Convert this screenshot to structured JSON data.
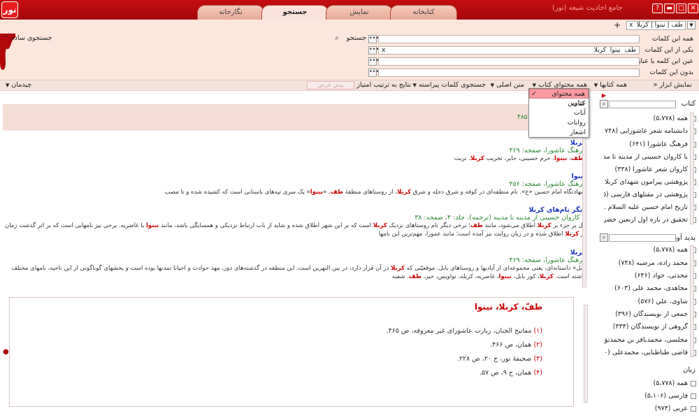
{
  "window": {
    "title": "جامع احادیث شیعه (نور)",
    "logo_text": "نور",
    "help": "?"
  },
  "tabs": [
    "نگارخانه",
    "جستجو",
    "نمایش",
    "کتابخانه"
  ],
  "query_tab": {
    "label": "طف | نینوا | کربلا",
    "close": "x",
    "add": "+"
  },
  "search": {
    "labels": [
      "همه این کلمات",
      "یکی از این کلمات",
      "عین این کلمه یا عبارت",
      "بدون این کلمات"
    ],
    "values": [
      "",
      "طف  نینوا  کربلا",
      "",
      ""
    ],
    "clear": "x",
    "search_button": "جستجو",
    "simple_search": "جستجوی ساده"
  },
  "toolbar": {
    "tools": "نمایش ابزار",
    "all_books": "همه کتابها",
    "all_content": "همه محتوای کتاب",
    "main_text": "متن اصلی",
    "refined": "جستجوی کلمات پیراسته",
    "sort": "نتایج به ترتیب امتیاز",
    "default": "پیش فرض",
    "layout": "چیدمان"
  },
  "dropdown": [
    "همه محتوای کتاب",
    "عناوین",
    "آیات",
    "روایات",
    "اشعار"
  ],
  "banner_count": "۴۸۵",
  "results": [
    {
      "title": "کربلا",
      "sub": "فرهنگ عاشورا، صفحه: ۳۶۹",
      "text_parts": [
        "-",
        "طف",
        "، ",
        "نینوا",
        ". حرم حسینی، حایر، تخریب ",
        "کربلا",
        ". تربت"
      ]
    },
    {
      "title": "نینوا",
      "sub": "فرهنگ عاشورا، صفحه: ۴۵۶",
      "text_parts": [
        "شهادتگاه امام حسین «ع». نام منطقه‌ای در کوفه و شرق دجله و شرق ",
        "کربلا",
        "، از روستاهای منطقهٔ ",
        "طف",
        ". «",
        "نینوا",
        "» یک سری تپه‌های باستانی است که کشیده شده و تا مصب"
      ]
    },
    {
      "title": "دیگر نام‌های کربلا",
      "sub": "با کاروان حسینی از مدینه تا مدینه (ترجمه)، جلد: ۴، صفحه: ۳۸",
      "text_parts": [
        "کل بر جزء بر ",
        "کربلا",
        " اطلاق می‌شود، مانند ",
        "طف",
        "؛ برخی دیگر نام روستاهای نزدیک ",
        "کربلا",
        " است که بر این شهر اطلاق شده و شاید از باب ارتباط نزدیکی و همسایگی باشد، مانند ",
        "نینوا",
        " یا غاضریه. برخی نیز نامهایی است که بر اثر گذشت زمان بر ",
        "کربلا",
        " اطلاق شده و در زبان روایت نیز آمده است؛ مانند عمورا. مهم‌ترین این نامها"
      ]
    },
    {
      "title": "کربلا",
      "sub": "فرهنگ عاشورا، صفحه: ۳۶۹",
      "text_parts": [
        "بابل» داستانه‌ای، یعنی مجموعه‌ای از آبادیها و روستاهای بابل. موقعیّتی که ",
        "کربلا",
        " در آن قرار دارد، در بین النهرین است. این منطقه در گذشته‌های دور، مهد حوادث و احیانا تمدنها بوده است و بخشهای گوناگونی از این ناحیه، نامهای مختلف داشته است. ",
        "کربلا",
        "، کور بابل، ",
        "نینوا",
        "، غاضریه، کربله، نواویس، حیر، ",
        "طف",
        ". شفیه"
      ]
    }
  ],
  "doc": {
    "title_parts": [
      "طفّ",
      "، ",
      "کربلا",
      "، ",
      "نینوا"
    ],
    "lines": [
      {
        "num": "(۱)",
        "text": " مفاتیح الجنان، زیارت عاشورای غیر معروفه، ص ۴۶۵."
      },
      {
        "num": "(۲)",
        "text": " همان، ص ۴۶۶."
      },
      {
        "num": "(۳)",
        "text": " صحیفهٔ نور، ج ۲۰، ص ۲۲۸."
      },
      {
        "num": "(۴)",
        "text": " همان، ج ۹، ص ۵۷."
      }
    ]
  },
  "sidebar": {
    "books_header": "کتاب",
    "books": [
      "همه (۵،۷۷۸)",
      "دانشنامه شعر عاشورایی (۷۴۸)",
      "فرهنگ عاشورا (۶۴۱)",
      "با کاروان حسینی از مدینه تا مدی...",
      "کاروان شعر عاشورا (۳۳۸)",
      "پژوهشی پیرامون شهدای کربلا (...",
      "پژوهشی در مقتلهای فارسی (۲۶۵)",
      "تاریخ امام حسین علیه السلام ...",
      "تحقیق در باره اول اربعین حضر..."
    ],
    "authors_header": "پدید آور",
    "authors": [
      "همه (۵،۷۷۸)",
      "محمد زاده، مرضیه (۷۴۸)",
      "محدثی، جواد (۶۴۶)",
      "مجاهدی، محمد علی (۶۰۳)",
      "شاوی، علي (۵۷۶)",
      "جمعی از نویسندگان (۳۹۶)",
      "گروهی از نویسندگان (۳۳۴)",
      "مجلسی، محمدباقر بن محمدتق...",
      "قاضی طباطبایی، محمدعلی (۲۳۰)"
    ],
    "lang_header": "زبان",
    "langs": [
      "همه (۵،۷۷۸)",
      "فارسی (۵،۱۰۶)",
      "عربی (۹۷۴)"
    ]
  },
  "colors": {
    "brand": "#c40d10",
    "highlight": "#cc0000",
    "title_blue": "#1a33c4",
    "source_green": "#2e8a36"
  }
}
